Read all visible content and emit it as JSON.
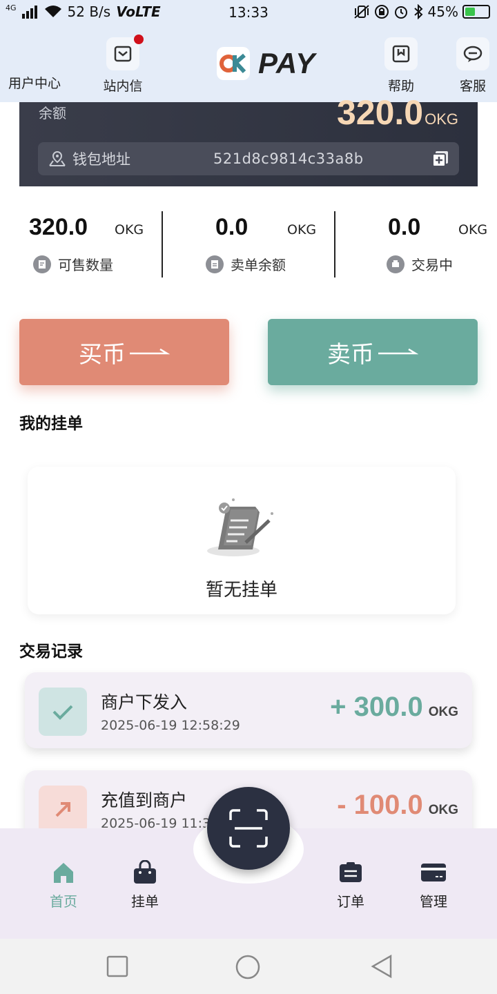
{
  "status_bar": {
    "net": "4G",
    "speed": "52 B/s",
    "volte": "VoLTE",
    "time": "13:33",
    "battery": "45%",
    "battery_level": 0.45
  },
  "header": {
    "user_center": "用户中心",
    "inbox": "站内信",
    "logo_mark": "OK",
    "logo_text": "PAY",
    "help": "帮助",
    "service": "客服"
  },
  "balance": {
    "label": "余额",
    "amount": "320.0",
    "unit": "OKG",
    "wallet_label": "钱包地址",
    "wallet_address": "521d8c9814c33a8b"
  },
  "stats": [
    {
      "value": "320.0",
      "unit": "OKG",
      "label": "可售数量"
    },
    {
      "value": "0.0",
      "unit": "OKG",
      "label": "卖单余额"
    },
    {
      "value": "0.0",
      "unit": "OKG",
      "label": "交易中"
    }
  ],
  "actions": {
    "buy": "买币",
    "sell": "卖币"
  },
  "my_orders": {
    "title": "我的挂单",
    "empty": "暂无挂单"
  },
  "records": {
    "title": "交易记录",
    "items": [
      {
        "title": "商户下发入",
        "time": "2025-06-19 12:58:29",
        "amount": "+ 300.0",
        "unit": "OKG"
      },
      {
        "title": "充值到商户",
        "time": "2025-06-19 11:3",
        "amount": "- 100.0",
        "unit": "OKG"
      }
    ]
  },
  "bottom_nav": {
    "home": "首页",
    "listing": "挂单",
    "orders": "订单",
    "manage": "管理"
  },
  "colors": {
    "accent_green": "#6aab9e",
    "accent_orange": "#e08a75",
    "dark": "#2b3041",
    "gold": "#f6d7b5"
  }
}
